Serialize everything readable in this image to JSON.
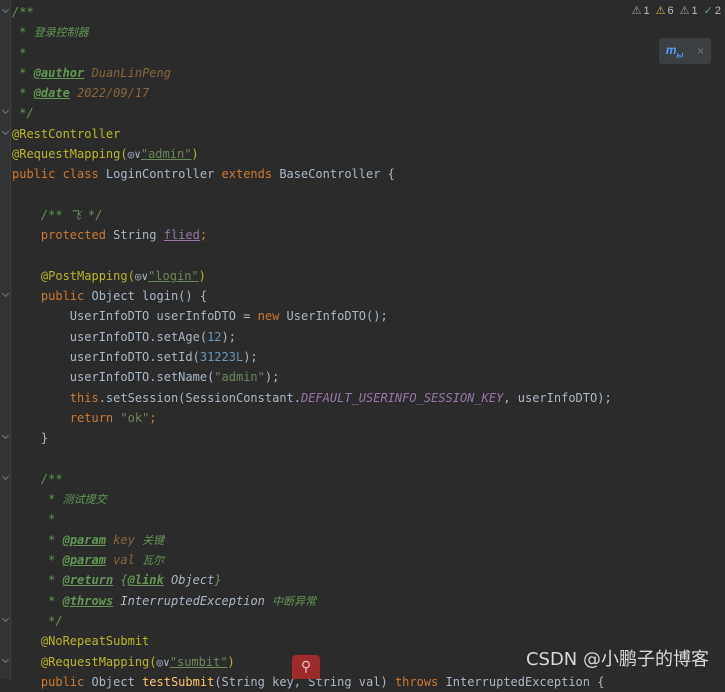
{
  "status": {
    "warn1_count": "1",
    "warn6_count": "6",
    "warn1b_count": "1",
    "ok_count": "2",
    "warn_glyph": "⚠",
    "ok_glyph": "✓"
  },
  "reader_mode": {
    "icon_text": "m",
    "sub_text": "ы",
    "close": "×"
  },
  "watermark": "CSDN @小鹏子的博客",
  "code": {
    "l1": "/**",
    "l2_star": " * ",
    "l2_text": "登录控制器",
    "l3": " *",
    "l4_star": " * ",
    "l4_tag": "@author",
    "l4_val": " DuanLinPeng",
    "l5_star": " * ",
    "l5_tag": "@date",
    "l5_val": " 2022/09/17",
    "l6": " */",
    "l7": "@RestController",
    "l8_ann": "@RequestMapping(",
    "l8_hint": "◎∨",
    "l8_str": "\"admin\"",
    "l8_end": ")",
    "l9_kw1": "public class ",
    "l9_name": "LoginController ",
    "l9_kw2": "extends ",
    "l9_rest": "BaseController {",
    "l11_doc": "/** ",
    "l11_cjk": "飞",
    "l11_end": " */",
    "l12_kw": "protected ",
    "l12_type": "String ",
    "l12_field": "flied",
    "l12_semi": ";",
    "l14_ann": "@PostMapping(",
    "l14_hint": "◎∨",
    "l14_str": "\"login\"",
    "l14_end": ")",
    "l15_kw": "public ",
    "l15_rest": "Object login() {",
    "l16_a": "UserInfoDTO userInfoDTO = ",
    "l16_kw": "new ",
    "l16_b": "UserInfoDTO();",
    "l17_a": "userInfoDTO.setAge(",
    "l17_num": "12",
    "l17_b": ");",
    "l18_a": "userInfoDTO.setId(",
    "l18_num": "31223L",
    "l18_b": ");",
    "l19_a": "userInfoDTO.setName(",
    "l19_str": "\"admin\"",
    "l19_b": ");",
    "l20_kw": "this",
    "l20_a": ".setSession(SessionConstant.",
    "l20_const": "DEFAULT_USERINFO_SESSION_KEY",
    "l20_b": ", userInfoDTO);",
    "l21_kw": "return ",
    "l21_str": "\"ok\"",
    "l21_b": ";",
    "l22": "}",
    "l24": "/**",
    "l25_star": " * ",
    "l25_cjk": "测试提交",
    "l26": " *",
    "l27_star": " * ",
    "l27_tag": "@param",
    "l27_val": " key ",
    "l27_cjk": "关键",
    "l28_star": " * ",
    "l28_tag": "@param",
    "l28_val": " val ",
    "l28_cjk": "瓦尔",
    "l29_star": " * ",
    "l29_tag": "@return",
    "l29_a": " {",
    "l29_link": "@link",
    "l29_ref": " Object",
    "l29_b": "}",
    "l30_star": " * ",
    "l30_tag": "@throws",
    "l30_ref": " InterruptedException ",
    "l30_cjk": "中断异常",
    "l31": " */",
    "l32": "@NoRepeatSubmit",
    "l33_ann": "@RequestMapping(",
    "l33_hint": "◎∨",
    "l33_str": "\"sumbit\"",
    "l33_end": ")",
    "l34_kw": "public ",
    "l34_a": "Object ",
    "l34_name": "testSubmit",
    "l34_b": "(String key, String val) ",
    "l34_kw2": "throws ",
    "l34_c": "InterruptedException {"
  }
}
